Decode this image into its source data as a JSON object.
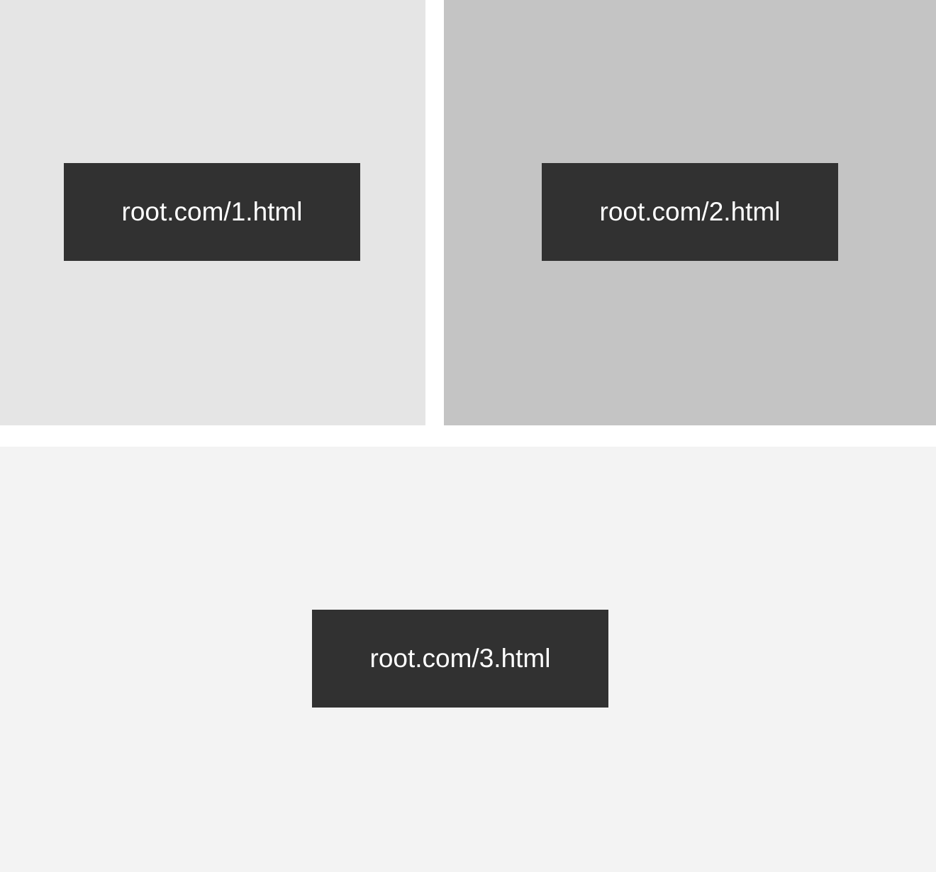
{
  "colors": {
    "background": "#ffffff",
    "box": "#313131",
    "box_text": "#ffffff"
  },
  "panels": [
    {
      "url": "root.com/1.html",
      "color": "#e5e5e5"
    },
    {
      "url": "root.com/2.html",
      "color": "#c4c4c4"
    },
    {
      "url": "root.com/3.html",
      "color": "#f3f3f3"
    }
  ]
}
